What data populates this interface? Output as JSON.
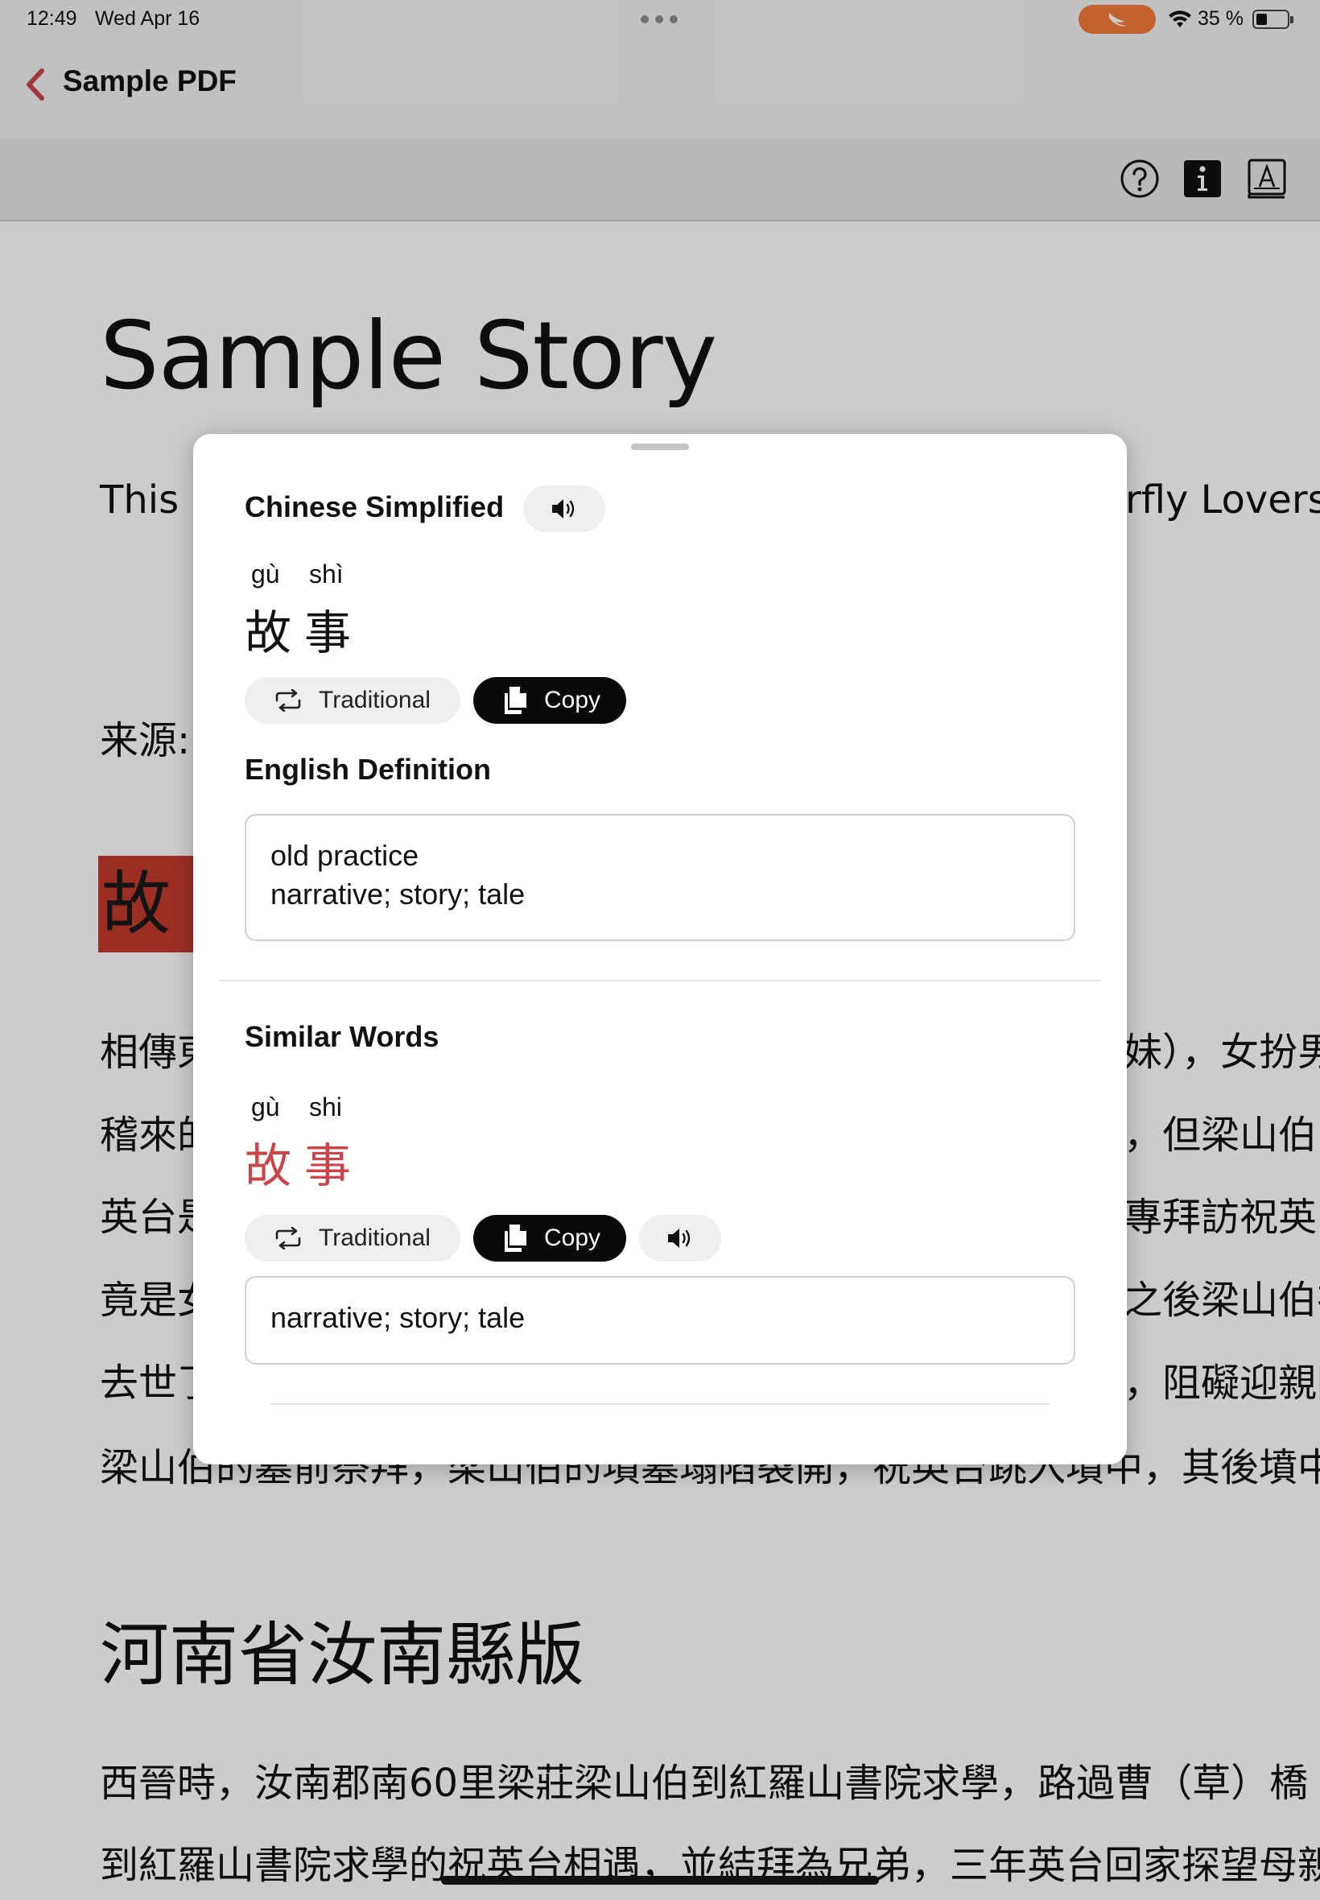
{
  "status_bar": {
    "time": "12:49",
    "date": "Wed Apr 16",
    "battery_percent": "35 %",
    "battery_level": 0.35
  },
  "nav": {
    "back_icon": "chevron-left-icon",
    "title": "Sample PDF"
  },
  "toolbar": {
    "icons": [
      "help-circle-icon",
      "info-icon",
      "dictionary-icon"
    ]
  },
  "document": {
    "title": "Sample Story",
    "intro_left": "This i",
    "intro_right": "rfly Lovers\"",
    "source_label": "来源:",
    "highlighted_word": "故事",
    "paragraph_lines_left": [
      "相傳東",
      "稽來的",
      "英台是",
      "竟是女",
      "去世了"
    ],
    "paragraph_lines_right": [
      "妹），女扮男",
      "，但梁山伯",
      "專拜訪祝英台",
      "之後梁山伯在",
      "，阻礙迎親隊"
    ],
    "para_full_line": "梁山伯的墓前祭拜，梁山伯的墳墓塌陷裂開，祝英台跳入墳中，其後墳中",
    "section_heading": "河南省汝南縣版",
    "section_line_1": "西晉時，汝南郡南60里梁莊梁山伯到紅羅山書院求學，路過曹（草）橋",
    "section_line_2": "到紅羅山書院求學的祝英台相遇，並結拜為兄弟，三年英台回家探望母親"
  },
  "popup": {
    "language_heading": "Chinese Simplified",
    "speaker_icon": "speaker-icon",
    "word": {
      "pinyin": [
        "gù",
        "shì"
      ],
      "characters": [
        "故",
        "事"
      ]
    },
    "traditional_label": "Traditional",
    "copy_label": "Copy",
    "definition_heading": "English Definition",
    "definition_lines": [
      "old practice",
      "narrative; story; tale"
    ],
    "similar_heading": "Similar Words",
    "similar": [
      {
        "pinyin": [
          "gù",
          "shi"
        ],
        "characters": [
          "故",
          "事"
        ],
        "traditional_label": "Traditional",
        "copy_label": "Copy",
        "definition": "narrative; story; tale"
      }
    ]
  }
}
